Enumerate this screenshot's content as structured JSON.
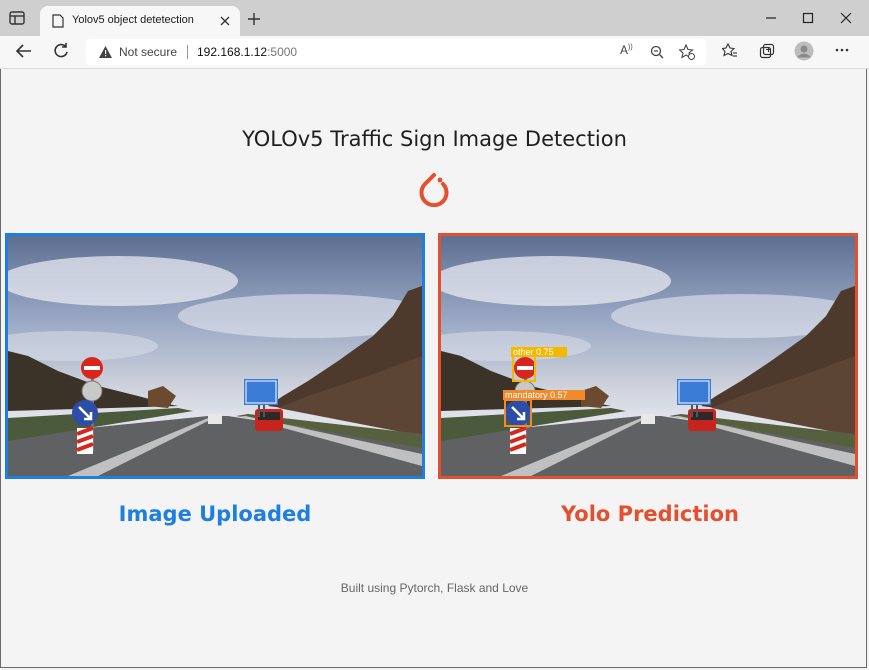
{
  "browser": {
    "tab_title": "Yolov5 object detetection",
    "security_label": "Not secure",
    "url_host": "192.168.1.12",
    "url_port": ":5000"
  },
  "page": {
    "title": "YOLOv5 Traffic Sign Image Detection",
    "uploaded_caption": "Image Uploaded",
    "prediction_caption": "Yolo Prediction",
    "footer": "Built using Pytorch, Flask and Love",
    "detections": [
      {
        "label": "other 0.75",
        "color": "#f5b800"
      },
      {
        "label": "mandatory 0.57",
        "color": "#f08a2a"
      }
    ]
  },
  "colors": {
    "uploaded_accent": "#1e7fe0",
    "prediction_accent": "#e4502f"
  },
  "icons": [
    "sidebar-icon",
    "page-icon",
    "close-icon",
    "plus-icon",
    "minimize-icon",
    "maximize-icon",
    "window-close-icon",
    "back-icon",
    "refresh-icon",
    "warning-icon",
    "read-aloud-icon",
    "zoom-icon",
    "favorite-add-icon",
    "favorites-icon",
    "collections-icon",
    "profile-icon",
    "more-icon",
    "pytorch-logo"
  ]
}
